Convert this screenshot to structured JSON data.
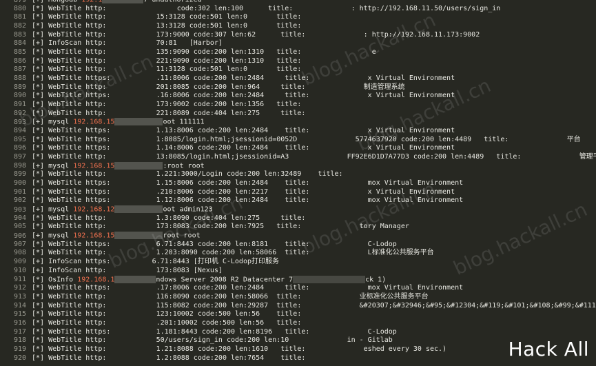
{
  "lines": [
    {
      "n": "879",
      "pre": "[+] Mongodb ",
      "ip": "192.1",
      "b1": 60,
      "mid": "7 unauthorized",
      "b2": 0,
      "tail": ""
    },
    {
      "n": "880",
      "pre": "[*] WebTitle http:",
      "ip": "",
      "b1": 0,
      "mid": "",
      "b2": 0,
      "tail": "                 code:302 len:100      title:              : http://192.168.11.50/users/sign_in"
    },
    {
      "n": "881",
      "pre": "[*] WebTitle http:",
      "ip": "",
      "b1": 0,
      "mid": "",
      "b2": 0,
      "tail": "            15:3128 code:501 len:0       title:"
    },
    {
      "n": "882",
      "pre": "[*] WebTitle http:",
      "ip": "",
      "b1": 0,
      "mid": "",
      "b2": 0,
      "tail": "            13:3128 code:501 len:0       title:"
    },
    {
      "n": "883",
      "pre": "[*] WebTitle http:",
      "ip": "",
      "b1": 0,
      "mid": "",
      "b2": 0,
      "tail": "            173:9000 code:307 len:62      title:              : http://192.168.11.173:9002"
    },
    {
      "n": "884",
      "pre": "[+] InfoScan http:",
      "ip": "",
      "b1": 0,
      "mid": "",
      "b2": 0,
      "tail": "            70:81   [Harbor]"
    },
    {
      "n": "885",
      "pre": "[*] WebTitle http:",
      "ip": "",
      "b1": 0,
      "mid": "",
      "b2": 0,
      "tail": "            135:9090 code:200 len:1310   title:                 e"
    },
    {
      "n": "886",
      "pre": "[*] WebTitle http:",
      "ip": "",
      "b1": 0,
      "mid": "",
      "b2": 0,
      "tail": "            221:9090 code:200 len:1310   title:"
    },
    {
      "n": "887",
      "pre": "[*] WebTitle http:",
      "ip": "",
      "b1": 0,
      "mid": "",
      "b2": 0,
      "tail": "            11:3128 code:501 len:0       title:"
    },
    {
      "n": "888",
      "pre": "[*] WebTitle https:",
      "ip": "",
      "b1": 0,
      "mid": "",
      "b2": 0,
      "tail": "           .11:8006 code:200 len:2484     title:              x Virtual Environment"
    },
    {
      "n": "889",
      "pre": "[*] WebTitle http:",
      "ip": "",
      "b1": 0,
      "mid": "",
      "b2": 0,
      "tail": "            201:8085 code:200 len:964     title:              制造管理系统"
    },
    {
      "n": "890",
      "pre": "[*] WebTitle https:",
      "ip": "",
      "b1": 0,
      "mid": "",
      "b2": 0,
      "tail": "           .16:8006 code:200 len:2484     title:              x Virtual Environment"
    },
    {
      "n": "891",
      "pre": "[*] WebTitle http:",
      "ip": "",
      "b1": 0,
      "mid": "",
      "b2": 0,
      "tail": "            173:9002 code:200 len:1356   title:"
    },
    {
      "n": "892",
      "pre": "[*] WebTitle http:",
      "ip": "",
      "b1": 0,
      "mid": "",
      "b2": 0,
      "tail": "            221:8089 code:404 len:275     title:"
    },
    {
      "n": "893",
      "pre": "[+] mysql ",
      "ip": "192.168.15",
      "b1": 70,
      "mid": "oot 111111",
      "b2": 0,
      "tail": ""
    },
    {
      "n": "894",
      "pre": "[*] WebTitle https:",
      "ip": "",
      "b1": 0,
      "mid": "",
      "b2": 0,
      "tail": "           1.13:8006 code:200 len:2484    title:              x Virtual Environment"
    },
    {
      "n": "895",
      "pre": "[*] WebTitle https:",
      "ip": "",
      "b1": 0,
      "mid": "",
      "b2": 0,
      "tail": "           1:8085/login.html;jsessionid=0052D              5774637920 code:200 len:4489   title:              平台"
    },
    {
      "n": "896",
      "pre": "[*] WebTitle https:",
      "ip": "",
      "b1": 0,
      "mid": "",
      "b2": 0,
      "tail": "           1.14:8006 code:200 len:2484    title:              x Virtual Environment"
    },
    {
      "n": "897",
      "pre": "[*] WebTitle http:",
      "ip": "",
      "b1": 0,
      "mid": "",
      "b2": 0,
      "tail": "            13:8085/login.html;jsessionid=A3              FF92E6D1D7A77D3 code:200 len:4489   title:              管理平"
    },
    {
      "n": "898",
      "pre": "[+] mysql ",
      "ip": "192.168.15",
      "b1": 70,
      "mid": ":root root",
      "b2": 0,
      "tail": ""
    },
    {
      "n": "899",
      "pre": "[*] WebTitle http:",
      "ip": "",
      "b1": 0,
      "mid": "",
      "b2": 0,
      "tail": "            1.221:3000/Login code:200 len:32489    title:"
    },
    {
      "n": "900",
      "pre": "[*] WebTitle https:",
      "ip": "",
      "b1": 0,
      "mid": "",
      "b2": 0,
      "tail": "           1.15:8006 code:200 len:2484    title:              mox Virtual Environment"
    },
    {
      "n": "901",
      "pre": "[*] WebTitle https:",
      "ip": "",
      "b1": 0,
      "mid": "",
      "b2": 0,
      "tail": "           .210:8006 code:200 len:2217    title:              x Virtual Environment"
    },
    {
      "n": "902",
      "pre": "[*] WebTitle https:",
      "ip": "",
      "b1": 0,
      "mid": "",
      "b2": 0,
      "tail": "           1.12:8006 code:200 len:2484    title:              mox Virtual Environment"
    },
    {
      "n": "903",
      "pre": "[+] mysql ",
      "ip": "192.168.12",
      "b1": 70,
      "mid": "oot admin123",
      "b2": 0,
      "tail": ""
    },
    {
      "n": "904",
      "pre": "[*] WebTitle http:",
      "ip": "",
      "b1": 0,
      "mid": "",
      "b2": 0,
      "tail": "            1.3:8090 code:404 len:275     title:"
    },
    {
      "n": "905",
      "pre": "[*] WebTitle http:",
      "ip": "",
      "b1": 0,
      "mid": "",
      "b2": 0,
      "tail": "            173:8083 code:200 len:7925   title:              tory Manager"
    },
    {
      "n": "906",
      "pre": "[+] mysql ",
      "ip": "192.168.15",
      "b1": 70,
      "mid": "root root",
      "b2": 0,
      "tail": ""
    },
    {
      "n": "907",
      "pre": "[*] WebTitle https:",
      "ip": "",
      "b1": 0,
      "mid": "",
      "b2": 0,
      "tail": "           6.71:8443 code:200 len:8181    title:              C-Lodop"
    },
    {
      "n": "908",
      "pre": "[*] WebTitle http:",
      "ip": "",
      "b1": 0,
      "mid": "",
      "b2": 0,
      "tail": "            1.203:8090 code:200 len:58066  title:              L标准化公共服务平台"
    },
    {
      "n": "909",
      "pre": "[+] InfoScan https:",
      "ip": "",
      "b1": 0,
      "mid": "",
      "b2": 0,
      "tail": "          6.71:8443 [打印机 C-Lodop打印服务"
    },
    {
      "n": "910",
      "pre": "[+] InfoScan http:",
      "ip": "",
      "b1": 0,
      "mid": "",
      "b2": 0,
      "tail": "            173:8083 [Nexus]"
    },
    {
      "n": "911",
      "pre": "[*] OsInfo ",
      "ip": "192.168.1",
      "b1": 60,
      "mid": "ndows Server 2008 R2 Datacenter 7",
      "b2": 105,
      "tail": "ck 1)"
    },
    {
      "n": "912",
      "pre": "[*] WebTitle https:",
      "ip": "",
      "b1": 0,
      "mid": "",
      "b2": 0,
      "tail": "           .17:8006 code:200 len:2484     title:              mox Virtual Environment"
    },
    {
      "n": "913",
      "pre": "[*] WebTitle http:",
      "ip": "",
      "b1": 0,
      "mid": "",
      "b2": 0,
      "tail": "            116:8090 code:200 len:58066  title:              业标准化公共服务平台"
    },
    {
      "n": "914",
      "pre": "[*] WebTitle http:",
      "ip": "",
      "b1": 0,
      "mid": "",
      "b2": 0,
      "tail": "            115:8082 code:200 len:29287  title:              &#20307;&#32946;&#95;&#12304;&#119;&#101;&#108;&#99;&#111;"
    },
    {
      "n": "915",
      "pre": "[*] WebTitle http:",
      "ip": "",
      "b1": 0,
      "mid": "",
      "b2": 0,
      "tail": "            123:10002 code:500 len:56    title:"
    },
    {
      "n": "916",
      "pre": "[*] WebTitle http:",
      "ip": "",
      "b1": 0,
      "mid": "",
      "b2": 0,
      "tail": "            .201:10002 code:500 len:56   title:"
    },
    {
      "n": "917",
      "pre": "[*] WebTitle https:",
      "ip": "",
      "b1": 0,
      "mid": "",
      "b2": 0,
      "tail": "           1.181:8443 code:200 len:8196   title:              C-Lodop"
    },
    {
      "n": "918",
      "pre": "[*] WebTitle http:",
      "ip": "",
      "b1": 0,
      "mid": "",
      "b2": 0,
      "tail": "            50/users/sign_in code:200 len:10              in - Gitlab"
    },
    {
      "n": "919",
      "pre": "[*] WebTitle http:",
      "ip": "",
      "b1": 0,
      "mid": "",
      "b2": 0,
      "tail": "            1.21:8088 code:200 len:1610   title:              eshed every 30 sec.)"
    },
    {
      "n": "920",
      "pre": "[*] WebTitle http:",
      "ip": "",
      "b1": 0,
      "mid": "",
      "b2": 0,
      "tail": "            1.2:8088 code:200 len:7654    title:"
    }
  ],
  "watermarks": [
    "blog.hackall.cn",
    "blog.hackall.cn",
    "blog.hackall.cn",
    "blog.hackall.cn",
    "blog.hackall.cn",
    "blog.hackall.cn"
  ],
  "brand": "Hack All"
}
